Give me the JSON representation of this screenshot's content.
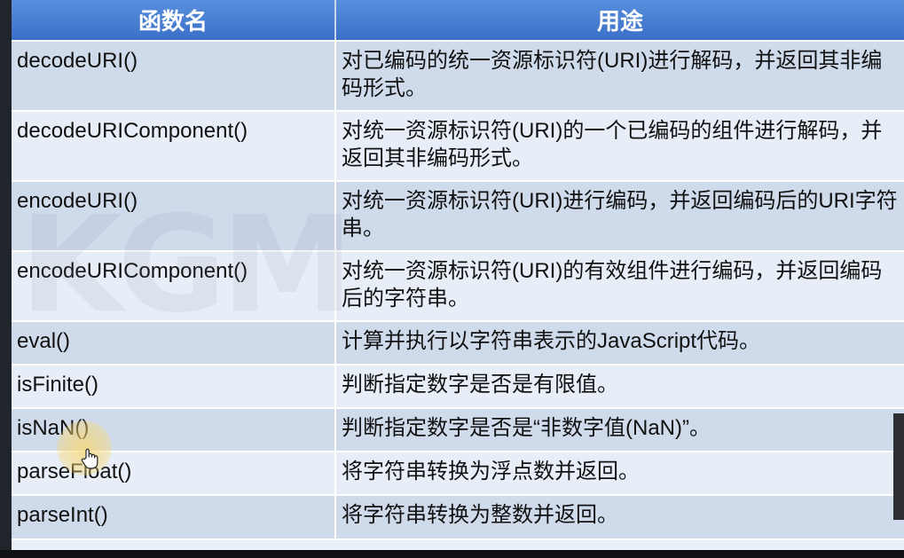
{
  "table": {
    "headers": {
      "name": "函数名",
      "purpose": "用途"
    },
    "rows": [
      {
        "name": "decodeURI()",
        "purpose": "对已编码的统一资源标识符(URI)进行解码，并返回其非编码形式。"
      },
      {
        "name": "decodeURIComponent()",
        "purpose": "对统一资源标识符(URI)的一个已编码的组件进行解码，并返回其非编码形式。"
      },
      {
        "name": "encodeURI()",
        "purpose": "对统一资源标识符(URI)进行编码，并返回编码后的URI字符串。"
      },
      {
        "name": "encodeURIComponent()",
        "purpose": "对统一资源标识符(URI)的有效组件进行编码，并返回编码后的字符串。"
      },
      {
        "name": "eval()",
        "purpose": "计算并执行以字符串表示的JavaScript代码。"
      },
      {
        "name": "isFinite()",
        "purpose": "判断指定数字是否是有限值。"
      },
      {
        "name": "isNaN()",
        "purpose": "判断指定数字是否是“非数字值(NaN)”。"
      },
      {
        "name": "parseFloat()",
        "purpose": "将字符串转换为浮点数并返回。"
      },
      {
        "name": "parseInt()",
        "purpose": "将字符串转换为整数并返回。"
      }
    ]
  },
  "colors": {
    "header_bg": "#3a70c8",
    "row_odd": "#cfdbeb",
    "row_even": "#e7eef7",
    "cursor_highlight": "#fad76e"
  },
  "icons": {
    "cursor": "hand-pointer-icon"
  }
}
